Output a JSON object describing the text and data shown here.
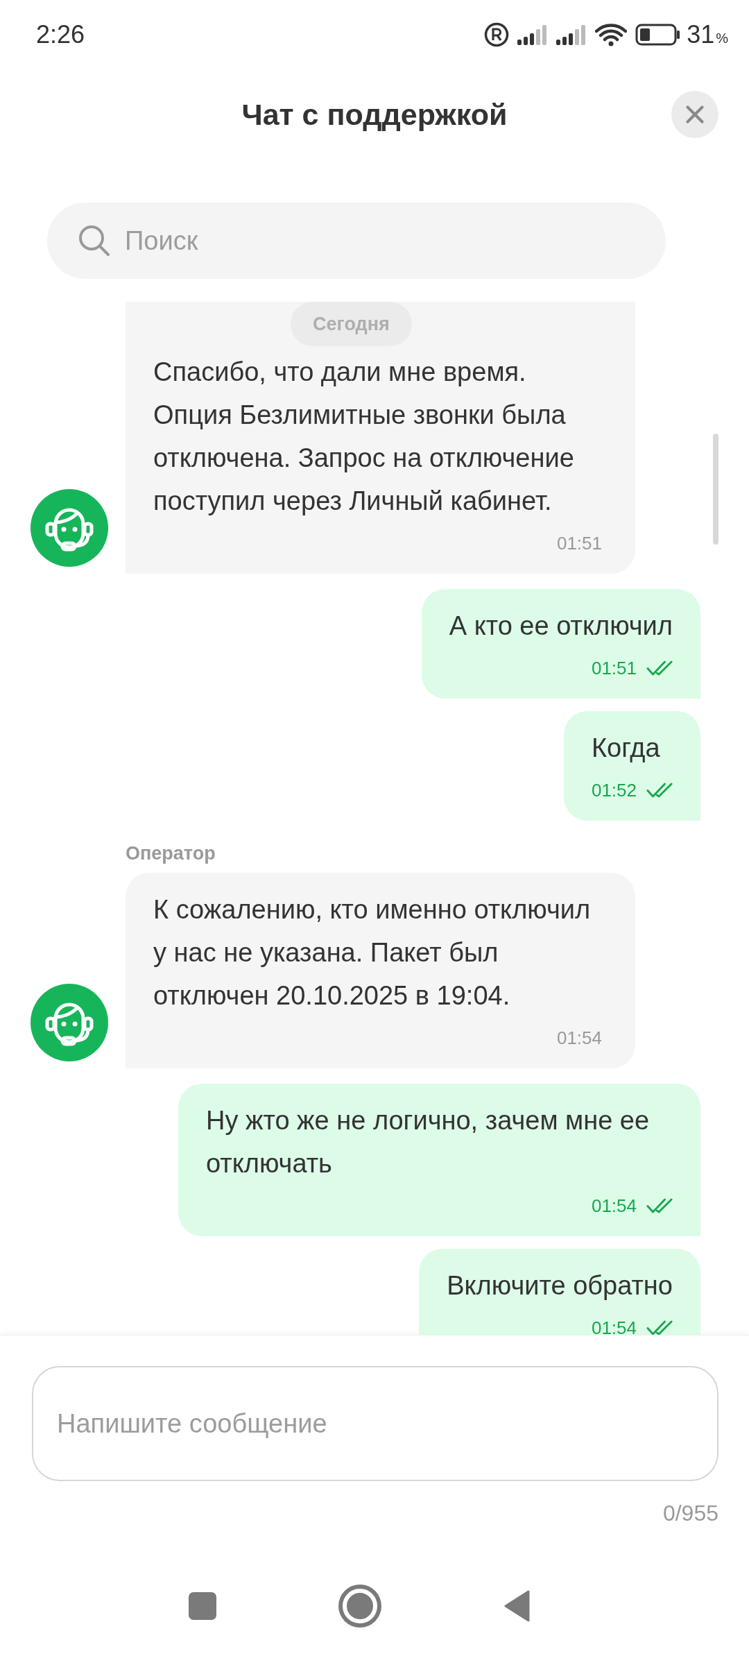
{
  "status_bar": {
    "time": "2:26",
    "battery": "31",
    "battery_unit": "%"
  },
  "header": {
    "title": "Чат с поддержкой"
  },
  "search": {
    "placeholder": "Поиск"
  },
  "date_badge": "Сегодня",
  "messages": [
    {
      "kind": "incoming",
      "cut_top": true,
      "text": "Спасибо, что дали мне время. Опция Безлимитные звонки была отключена. Запрос на отключение поступил через Личный кабинет.",
      "time": "01:51"
    },
    {
      "kind": "outgoing",
      "text": "А кто ее отключил",
      "time": "01:51",
      "read": true
    },
    {
      "kind": "outgoing",
      "text": "Когда",
      "time": "01:52",
      "read": true
    },
    {
      "kind": "incoming",
      "sender": "Оператор",
      "text": "К сожалению, кто именно отключил у нас не указана. Пакет был отключен 20.10.2025 в 19:04.",
      "time": "01:54"
    },
    {
      "kind": "outgoing",
      "text": "Ну жто же не логично, зачем мне ее отключать",
      "time": "01:54",
      "read": true
    },
    {
      "kind": "outgoing",
      "text": "Включите обратно",
      "time": "01:54",
      "read": true
    }
  ],
  "composer": {
    "placeholder": "Напишите сообщение",
    "counter": "0/955"
  }
}
